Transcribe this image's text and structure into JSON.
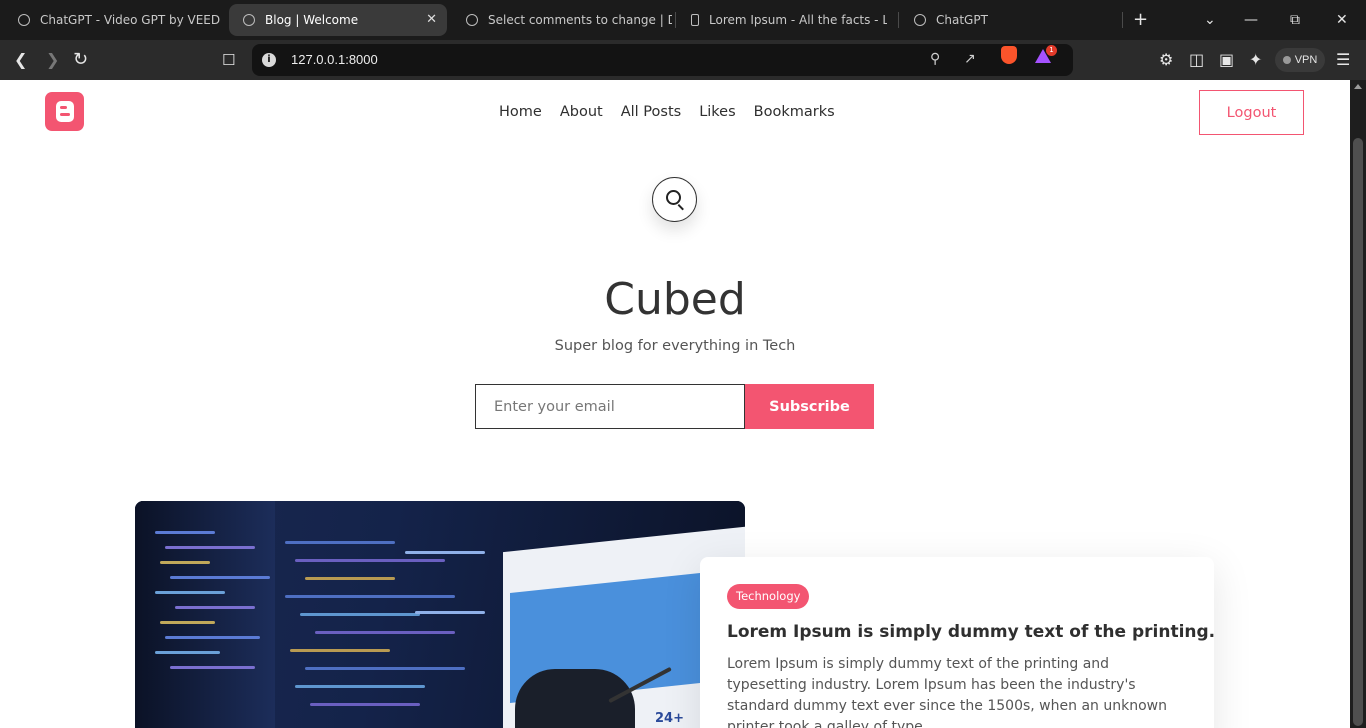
{
  "browser": {
    "tabs": [
      {
        "title": "ChatGPT - Video GPT by VEED",
        "active": false
      },
      {
        "title": "Blog | Welcome",
        "active": true
      },
      {
        "title": "Select comments to change | Dja",
        "active": false
      },
      {
        "title": "Lorem Ipsum - All the facts - Lips",
        "active": false
      },
      {
        "title": "ChatGPT",
        "active": false
      }
    ],
    "new_tab": "+",
    "tab_close": "✕",
    "url": "127.0.0.1:8000",
    "extension_badge": "1",
    "vpn_label": "VPN"
  },
  "site": {
    "nav": [
      "Home",
      "About",
      "All Posts",
      "Likes",
      "Bookmarks"
    ],
    "logout_label": "Logout",
    "hero": {
      "title": "Cubed",
      "subtitle": "Super blog for everything in Tech"
    },
    "subscribe": {
      "placeholder": "Enter your email",
      "button_label": "Subscribe"
    },
    "featured_post": {
      "category": "Technology",
      "title": "Lorem Ipsum is simply dummy text of the printing.",
      "excerpt": "Lorem Ipsum is simply dummy text of the printing and typesetting industry. Lorem Ipsum has been the industry's standard dummy text ever since the 1500s, when an unknown printer took a galley of type"
    }
  },
  "colors": {
    "accent": "#f35571",
    "text": "#2f2f2f",
    "browser_bg": "#1b1b1b"
  }
}
